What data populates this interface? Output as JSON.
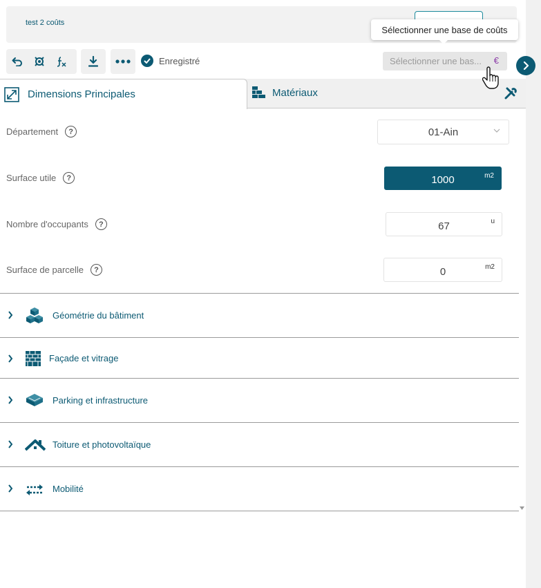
{
  "header": {
    "project_name": "test 2 coûts",
    "tooltip": "Sélectionner une base de coûts"
  },
  "toolbar": {
    "icons": [
      "undo-icon",
      "target-icon",
      "fx-function-icon",
      "download-icon",
      "more-icon"
    ],
    "saved_label": "Enregistré",
    "cost_select_placeholder": "Sélectionner une bas...",
    "cost_select_currency": "€"
  },
  "tabs": [
    {
      "label": "Dimensions Principales",
      "icon": "expand-icon",
      "active": true
    },
    {
      "label": "Matériaux",
      "icon": "bricks-icon",
      "active": false
    }
  ],
  "fields": [
    {
      "label": "Département",
      "value": "01-Ain",
      "type": "select"
    },
    {
      "label": "Surface utile",
      "value": "1000",
      "unit": "m2",
      "filled": true
    },
    {
      "label": "Nombre d'occupants",
      "value": "67",
      "unit": "u"
    },
    {
      "label": "Surface de parcelle",
      "value": "0",
      "unit": "m2"
    }
  ],
  "sections": [
    {
      "label": "Géométrie du bâtiment",
      "icon": "cubes-icon"
    },
    {
      "label": "Façade et vitrage",
      "icon": "facade-icon"
    },
    {
      "label": "Parking et infrastructure",
      "icon": "parking-icon"
    },
    {
      "label": "Toiture et photovoltaïque",
      "icon": "roof-icon"
    },
    {
      "label": "Mobilité",
      "icon": "mobility-icon"
    }
  ],
  "colors": {
    "accent": "#0c5a73",
    "currency": "#8b3aa8"
  }
}
